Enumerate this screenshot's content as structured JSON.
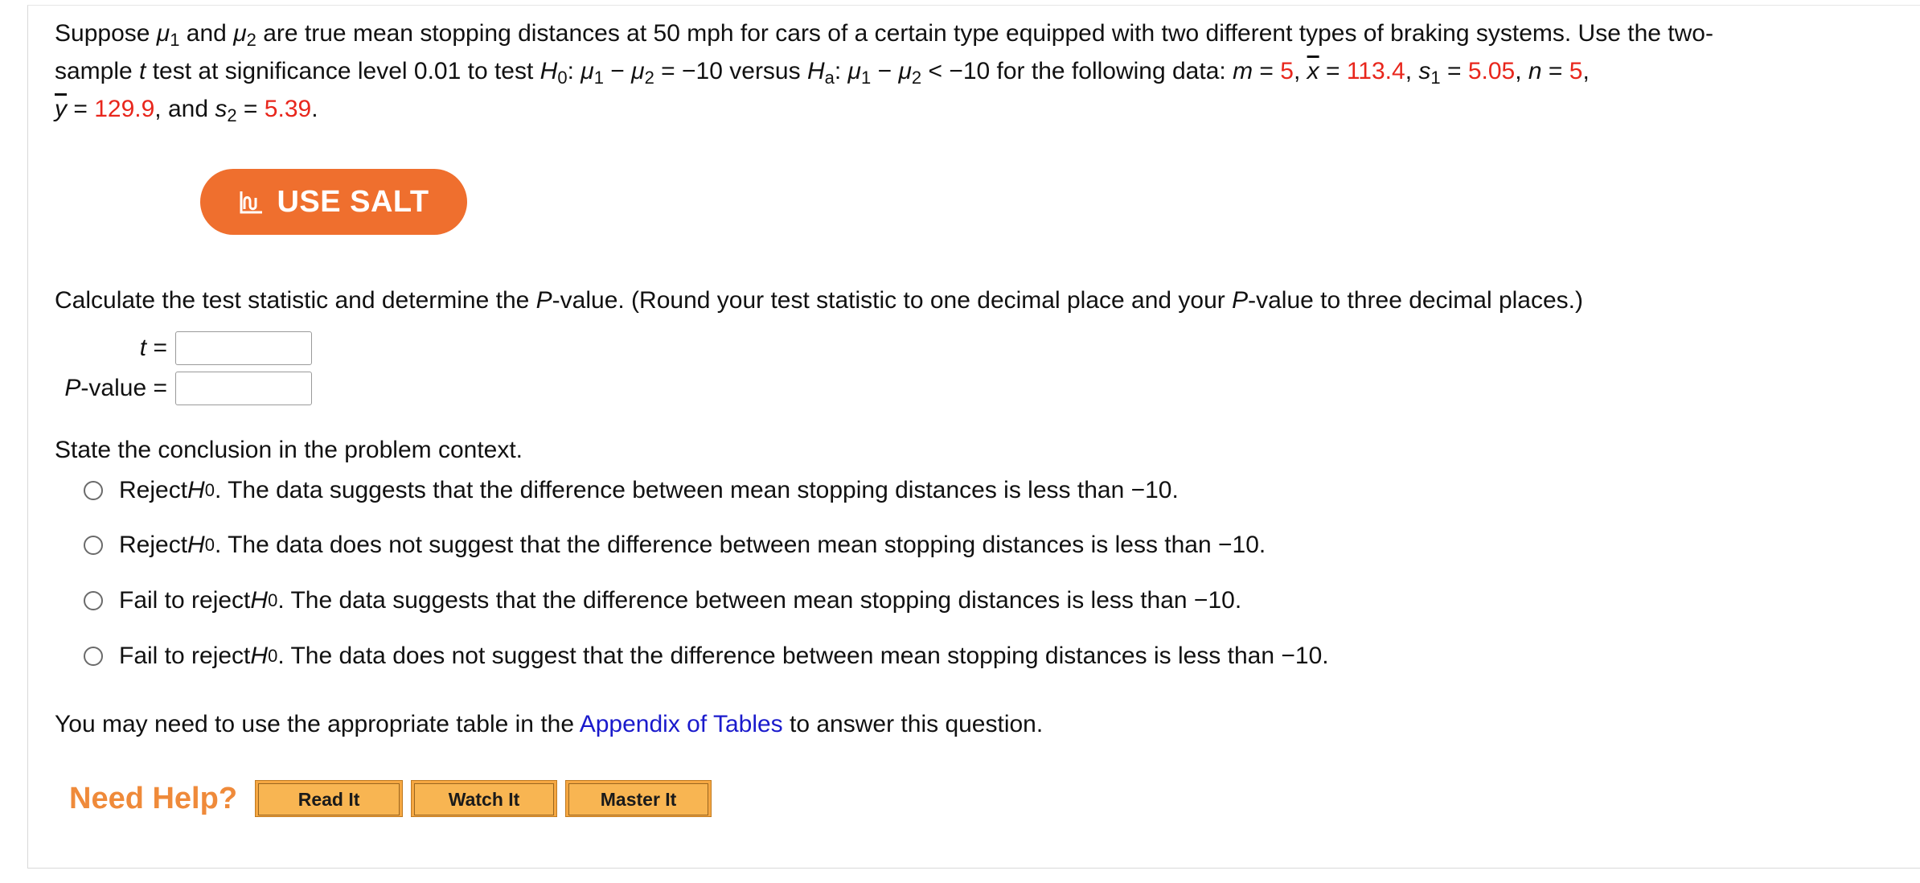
{
  "problem": {
    "p1": "Suppose ",
    "mu": "μ",
    "sub1": "1",
    "sub2": "2",
    "and": " and ",
    "p2": " are true mean stopping distances at 50 mph for cars of a certain type equipped with two different types of braking systems. Use the two-",
    "p3": "sample ",
    "t": "t",
    "p4": " test at significance level 0.01 to test ",
    "H": "H",
    "sub0": "0",
    "suba": "a",
    "colon": ": ",
    "minus": " − ",
    "null_rhs": " = −10 versus ",
    "alt_rhs": " < −10 for the following data: ",
    "m_label": "m",
    "eq": " = ",
    "m_val": "5",
    "comma": ", ",
    "xbar": "x",
    "xbar_val": "113.4",
    "s": "s",
    "s1_val": "5.05",
    "n_label": "n",
    "n_val": "5",
    "ybar": "y",
    "ybar_val": "129.9",
    "and2": ", and ",
    "s2_val": "5.39",
    "period": "."
  },
  "salt": {
    "label": "USE SALT",
    "icon": "salt-icon"
  },
  "instructions": {
    "a": "Calculate the test statistic and determine the ",
    "P": "P",
    "b": "-value. (Round your test statistic to one decimal place and your ",
    "c": "-value to three decimal places.)"
  },
  "fields": {
    "t_label": "t",
    "eq": " = ",
    "t_value": "",
    "p_label_tail": "-value",
    "p_value": ""
  },
  "conclusion": {
    "prompt": "State the conclusion in the problem context.",
    "options": [
      {
        "lead": "Reject ",
        "rest": ". The data suggests that the difference between mean stopping distances is less than −10."
      },
      {
        "lead": "Reject ",
        "rest": ". The data does not suggest that the difference between mean stopping distances is less than −10."
      },
      {
        "lead": "Fail to reject ",
        "rest": ". The data suggests that the difference between mean stopping distances is less than −10."
      },
      {
        "lead": "Fail to reject ",
        "rest": ". The data does not suggest that the difference between mean stopping distances is less than −10."
      }
    ]
  },
  "appendix": {
    "before": "You may need to use the appropriate table in the ",
    "link": "Appendix of Tables",
    "after": " to answer this question."
  },
  "help": {
    "label": "Need Help?",
    "buttons": [
      "Read It",
      "Watch It",
      "Master It"
    ]
  },
  "colors": {
    "accent": "#ef6f2e",
    "value_red": "#e8261c",
    "link": "#1a1acc",
    "help_orange": "#ef8a3a"
  }
}
